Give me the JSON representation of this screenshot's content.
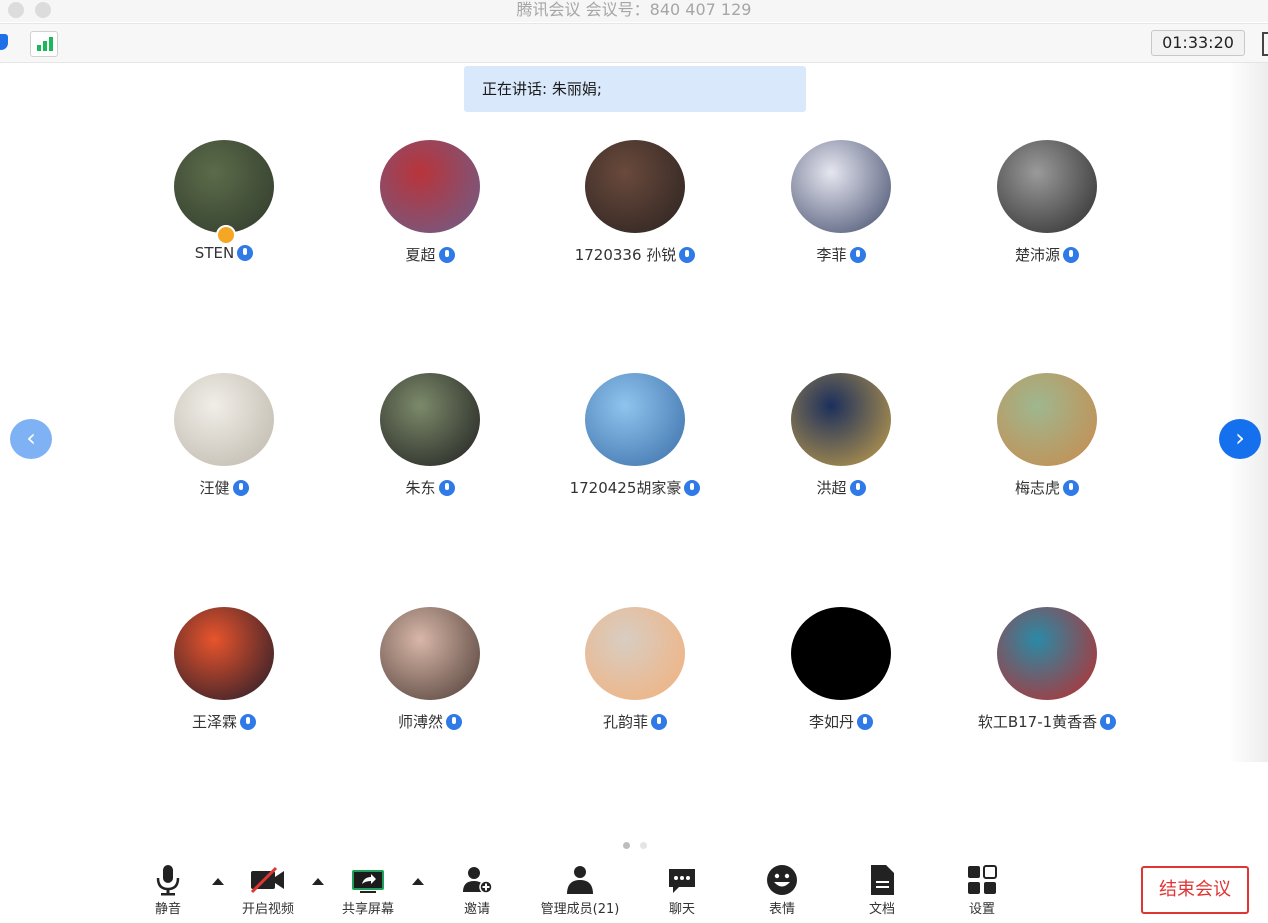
{
  "window": {
    "title": "腾讯会议 会议号：840 407 129",
    "timer": "01:33:20"
  },
  "banner": {
    "speaking_text": "正在讲话: 朱丽娟;"
  },
  "participants": [
    {
      "name": "STEN",
      "avatar_colors": [
        "#5c6b4a",
        "#2f3a2b"
      ],
      "host": true
    },
    {
      "name": "夏超",
      "avatar_colors": [
        "#b9343a",
        "#6b5f8c"
      ]
    },
    {
      "name": "1720336 孙锐",
      "avatar_colors": [
        "#6a4a3c",
        "#2a2220"
      ]
    },
    {
      "name": "李菲",
      "avatar_colors": [
        "#e6e6f0",
        "#404a6a"
      ]
    },
    {
      "name": "楚沛源",
      "avatar_colors": [
        "#9a9a9a",
        "#2a2a2a"
      ]
    },
    {
      "name": "汪健",
      "avatar_colors": [
        "#f0eee8",
        "#bdb6aa"
      ]
    },
    {
      "name": "朱东",
      "avatar_colors": [
        "#7c8a6a",
        "#1f1f1f"
      ]
    },
    {
      "name": "1720425胡家豪",
      "avatar_colors": [
        "#8fc4ee",
        "#3a6ea8"
      ]
    },
    {
      "name": "洪超",
      "avatar_colors": [
        "#1c2f5c",
        "#c7a24b"
      ]
    },
    {
      "name": "梅志虎",
      "avatar_colors": [
        "#9fb78f",
        "#c98a4c"
      ]
    },
    {
      "name": "王泽霖",
      "avatar_colors": [
        "#e8542c",
        "#1e1a2a"
      ]
    },
    {
      "name": "师溥然",
      "avatar_colors": [
        "#d8b7a8",
        "#4b3a34"
      ]
    },
    {
      "name": "孔韵菲",
      "avatar_colors": [
        "#d8cdc2",
        "#f3b07a"
      ]
    },
    {
      "name": "李如丹",
      "avatar_colors": [
        "#000000",
        "#000000"
      ]
    },
    {
      "name": "软工B17-1黄香香",
      "avatar_colors": [
        "#2a8aa6",
        "#c02a2a"
      ]
    }
  ],
  "toolbar": {
    "mute": "静音",
    "video": "开启视频",
    "share": "共享屏幕",
    "invite": "邀请",
    "members": "管理成员(21)",
    "chat": "聊天",
    "emoji": "表情",
    "docs": "文档",
    "settings": "设置",
    "end": "结束会议"
  },
  "nav": {
    "prev": "‹",
    "next": "›"
  },
  "colors": {
    "accent": "#1570ee",
    "end": "#e03535",
    "signal": "#19b95a"
  }
}
